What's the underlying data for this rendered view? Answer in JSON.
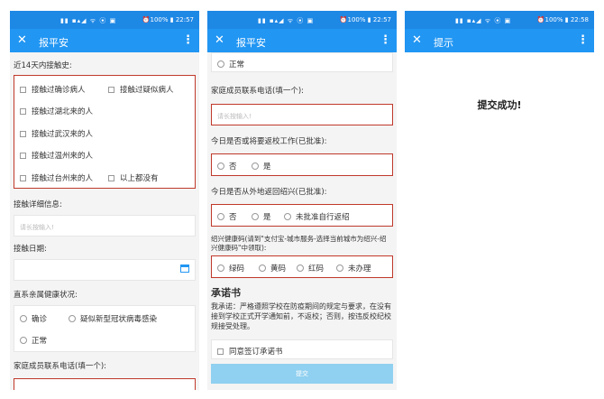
{
  "status": {
    "signal": "▮▮ ▪▴◢ ᯤ ⦿ ▣",
    "time1": "22:57",
    "time2": "22:57",
    "time3": "22:58",
    "battery": "100%"
  },
  "screen1": {
    "title": "报平安",
    "contact_label": "近14天内接触史:",
    "contact_options": [
      "接触过确诊病人",
      "接触过疑似病人",
      "接触过湖北来的人",
      "接触过武汉来的人",
      "接触过温州来的人",
      "接触过台州来的人",
      "以上都没有"
    ],
    "detail_label": "接触详细信息:",
    "detail_placeholder": "请长按输入!",
    "date_label": "接触日期:",
    "family_label": "直系亲属健康状况:",
    "family_options": [
      "确诊",
      "疑似新型冠状病毒感染",
      "正常"
    ],
    "phone_label": "家庭成员联系电话(填一个):"
  },
  "screen2": {
    "title": "报平安",
    "normal_option": "正常",
    "phone_label": "家庭成员联系电话(填一个):",
    "phone_placeholder": "请长按输入!",
    "return_label": "今日是否或将要返校工作(已批准):",
    "return_options": [
      "否",
      "是"
    ],
    "outside_label": "今日是否从外地返回绍兴(已批准):",
    "outside_options": [
      "否",
      "是",
      "未批准自行返绍"
    ],
    "health_code_label": "绍兴健康码(请到\"支付宝-城市服务-选择当前城市为绍兴-绍兴健康码\"中领取):",
    "health_code_options": [
      "绿码",
      "黄码",
      "红码",
      "未办理"
    ],
    "pledge_heading": "承诺书",
    "pledge_text": "我承诺：严格遵照学校在防疫期间的规定与要求，在没有接到学校正式开学通知前，不返校；否则，按违反校纪校规接受处理。",
    "agree_label": "同意签订承诺书",
    "submit_label": "提交"
  },
  "screen3": {
    "title": "提示",
    "message": "提交成功!"
  }
}
